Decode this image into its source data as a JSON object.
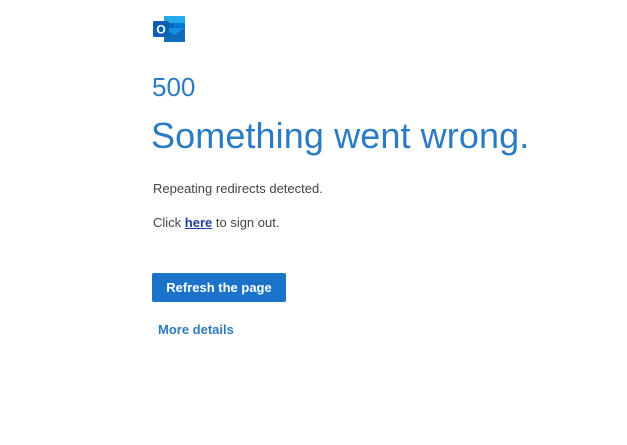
{
  "brand": {
    "logo_icon": "outlook-logo-icon",
    "logo_letter": "O",
    "accent_color": "#2b7bc4",
    "button_color": "#1a73c8"
  },
  "error": {
    "code": "500",
    "headline": "Something went wrong.",
    "message": "Repeating redirects detected."
  },
  "signout": {
    "prefix": "Click ",
    "link_text": "here",
    "suffix": " to sign out."
  },
  "actions": {
    "refresh_label": "Refresh the page",
    "more_details_label": "More details"
  }
}
